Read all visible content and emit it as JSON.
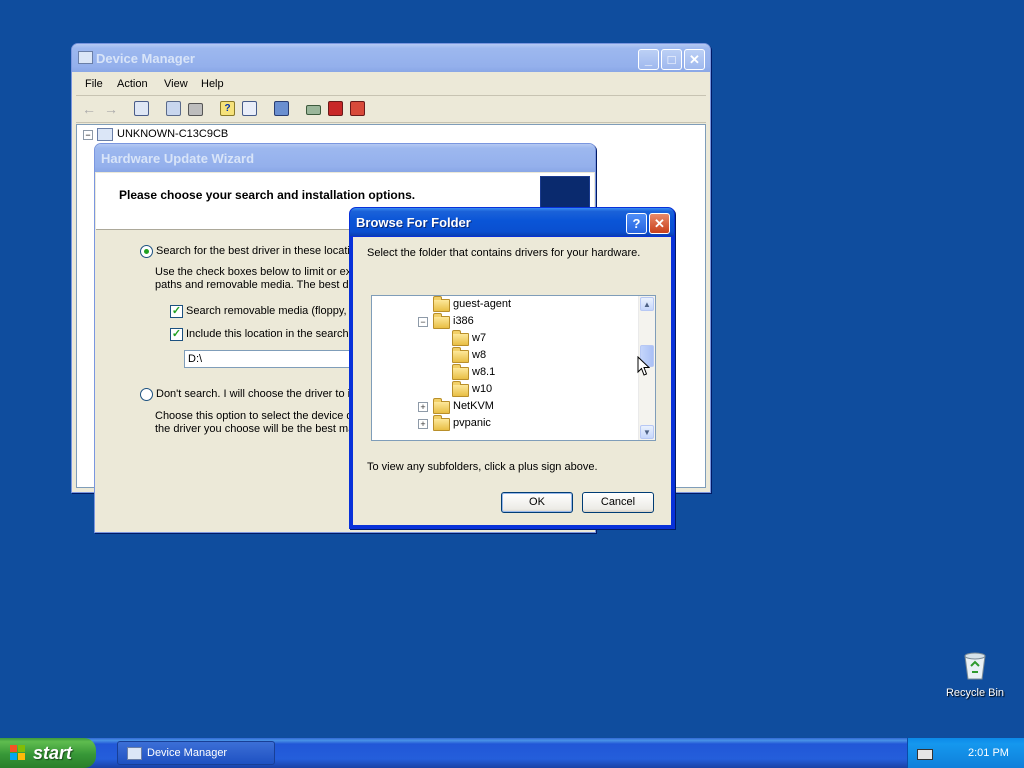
{
  "device_manager": {
    "title": "Device Manager",
    "menu": [
      "File",
      "Action",
      "View",
      "Help"
    ],
    "toolbar_icons": [
      "back-icon",
      "forward-icon",
      "show-hide-tree-icon",
      "properties-icon",
      "print-icon",
      "help-icon",
      "details-icon",
      "scan-hardware-icon",
      "update-driver-icon",
      "disable-icon",
      "uninstall-icon"
    ],
    "tree_root": "UNKNOWN-C13C9CB"
  },
  "wizard": {
    "title": "Hardware Update Wizard",
    "header": "Please choose your search and installation options.",
    "option1_label": "Search for the best driver in these locatio",
    "option1_desc_line1": "Use the check boxes below to limit or exp",
    "option1_desc_line2": "paths and removable media. The best driv",
    "check1_label": "Search removable media (floppy, C",
    "check2_label": "Include this location in the search:",
    "path_value": "D:\\",
    "option2_label": "Don't search. I will choose the driver to in",
    "option2_desc_line1": "Choose this option to select the device dr",
    "option2_desc_line2": "the driver you choose will be the best mat"
  },
  "browse": {
    "title": "Browse For Folder",
    "help_button": "?",
    "instruction": "Select the folder that contains drivers for your hardware.",
    "tree": [
      {
        "label": "guest-agent",
        "expander": ""
      },
      {
        "label": "i386",
        "expander": "−"
      },
      {
        "label": "w7",
        "expander": ""
      },
      {
        "label": "w8",
        "expander": ""
      },
      {
        "label": "w8.1",
        "expander": ""
      },
      {
        "label": "w10",
        "expander": ""
      },
      {
        "label": "NetKVM",
        "expander": "+"
      },
      {
        "label": "pvpanic",
        "expander": "+"
      }
    ],
    "footer": "To view any subfolders, click a plus sign above.",
    "ok": "OK",
    "cancel": "Cancel"
  },
  "desktop": {
    "recycle_bin": "Recycle Bin"
  },
  "taskbar": {
    "start": "start",
    "item": "Device Manager",
    "clock": "2:01 PM"
  }
}
